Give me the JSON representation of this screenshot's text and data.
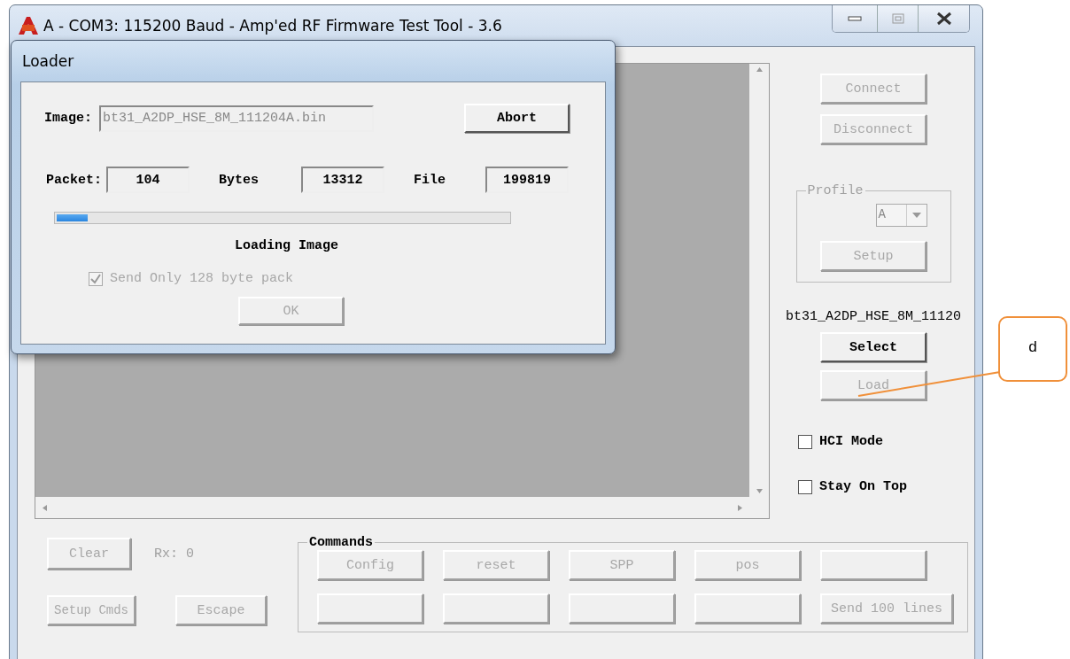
{
  "window": {
    "title": "A - COM3: 115200 Baud - Amp'ed RF Firmware Test Tool - 3.6"
  },
  "right_panel": {
    "connection_buttons": [
      {
        "label": "Connect",
        "disabled": true
      },
      {
        "label": "Disconnect",
        "disabled": true
      }
    ],
    "profile": {
      "label": "Profile",
      "value": "A",
      "disabled": true,
      "setup_button": {
        "label": "Setup",
        "disabled": true
      }
    },
    "file_name": "bt31_A2DP_HSE_8M_11120",
    "file_buttons": [
      {
        "label": "Select",
        "disabled": false
      },
      {
        "label": "Load",
        "disabled": true
      }
    ],
    "checkboxes": [
      {
        "label": "HCI Mode",
        "checked": false
      },
      {
        "label": "Stay On Top",
        "checked": false
      }
    ]
  },
  "bottom": {
    "clear_button": {
      "label": "Clear",
      "disabled": true
    },
    "rx": "Rx: 0",
    "setup_cmds_button": {
      "label": "Setup Cmds",
      "disabled": true
    },
    "escape_button": {
      "label": "Escape",
      "disabled": true
    },
    "commands": {
      "label": "Commands",
      "buttons": [
        {
          "label": "Config",
          "disabled": true
        },
        {
          "label": "reset",
          "disabled": true
        },
        {
          "label": "SPP",
          "disabled": true
        },
        {
          "label": "pos",
          "disabled": true
        },
        {
          "disabled": true
        },
        {
          "disabled": true
        },
        {
          "disabled": true
        },
        {
          "disabled": true
        },
        {
          "disabled": true
        },
        {
          "label": "Send 100 lines",
          "disabled": true
        }
      ]
    }
  },
  "loader": {
    "title": "Loader",
    "image_label": "Image:",
    "image_value": "bt31_A2DP_HSE_8M_111204A.bin",
    "abort_button": {
      "label": "Abort",
      "disabled": false
    },
    "counters": [
      {
        "label": "Packet:",
        "value": "104"
      },
      {
        "label": "Bytes",
        "value": "13312"
      },
      {
        "label": "File",
        "value": "199819"
      }
    ],
    "progress": {
      "level": 0.07
    },
    "status": "Loading Image",
    "checkbox": {
      "label": "Send Only 128 byte pack",
      "checked": true,
      "disabled": true
    },
    "ok_button": {
      "label": "OK",
      "disabled": true
    }
  },
  "callout": {
    "label": "d"
  }
}
